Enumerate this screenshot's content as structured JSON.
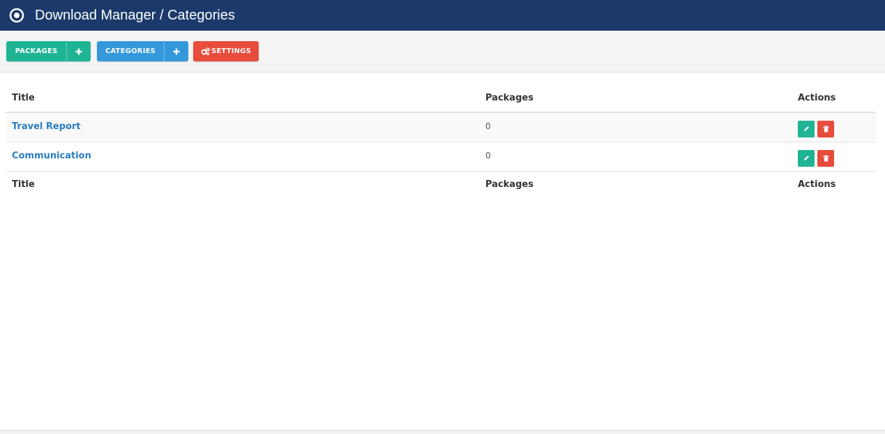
{
  "header": {
    "title": "Download Manager / Categories",
    "icon": "target-icon"
  },
  "toolbar": {
    "packages_label": "PACKAGES",
    "categories_label": "CATEGORIES",
    "settings_label": "SETTINGS"
  },
  "table": {
    "columns": [
      "Title",
      "Packages",
      "Actions"
    ],
    "rows": [
      {
        "title": "Travel Report",
        "packages": "0"
      },
      {
        "title": "Communication",
        "packages": "0"
      }
    ]
  },
  "colors": {
    "header": "#1b3a6b",
    "green": "#1fb494",
    "blue": "#3498db",
    "red": "#e74c3c",
    "link": "#2a7dc1"
  }
}
